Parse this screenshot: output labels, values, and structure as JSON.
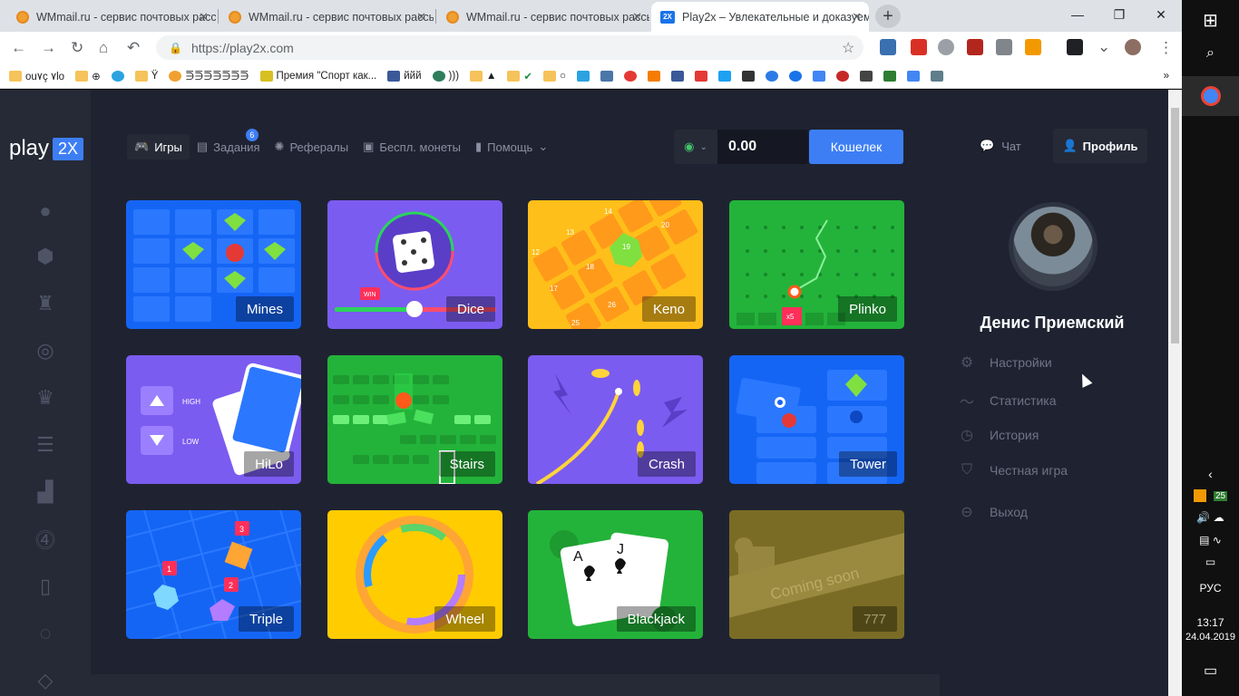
{
  "browser": {
    "tabs": [
      {
        "title": "WMmail.ru - сервис почтовых рассы",
        "active": false
      },
      {
        "title": "WMmail.ru - сервис почтовых рассы",
        "active": false
      },
      {
        "title": "WMmail.ru - сервис почтовых рассы",
        "active": false
      },
      {
        "title": "Play2x – Увлекательные и доказуем",
        "active": true,
        "favicon": "2X"
      }
    ],
    "url": "https://play2x.com",
    "window_controls": {
      "minimize": "—",
      "maximize": "❐",
      "close": "✕"
    },
    "bookmarks": [
      "ou٧ç ٧lo",
      "⊕",
      "",
      "Ÿ",
      "⋽⋽⋽⋽⋽⋽⋽",
      "Премия \"Спорт как...",
      "ййй",
      ")))",
      "▲",
      "✔",
      "○"
    ]
  },
  "taskbar": {
    "lang": "РУС",
    "time": "13:17",
    "date": "24.04.2019",
    "notif_count": "25"
  },
  "site": {
    "logo_text": "play",
    "logo_badge": "2X",
    "menu": [
      {
        "label": "Игры",
        "icon": "gamepad-icon",
        "active": true
      },
      {
        "label": "Задания",
        "icon": "list-icon",
        "badge": "6"
      },
      {
        "label": "Рефералы",
        "icon": "referral-icon"
      },
      {
        "label": "Беспл. монеты",
        "icon": "gift-icon"
      },
      {
        "label": "Помощь",
        "icon": "help-icon"
      }
    ],
    "balance": "0.00",
    "wallet_button": "Кошелек",
    "chat_label": "Чат",
    "profile_button": "Профиль",
    "user_name": "Денис Приемский",
    "profile_links": [
      {
        "label": "Настройки",
        "icon": "gear-icon"
      },
      {
        "label": "Статистика",
        "icon": "stats-icon"
      },
      {
        "label": "История",
        "icon": "clock-icon"
      },
      {
        "label": "Честная игра",
        "icon": "shield-icon"
      },
      {
        "label": "Выход",
        "icon": "logout-icon"
      }
    ],
    "games": [
      {
        "name": "Mines",
        "color": "#1565f5"
      },
      {
        "name": "Dice",
        "color": "#7b5cf0"
      },
      {
        "name": "Keno",
        "color": "#ffbf1a"
      },
      {
        "name": "Plinko",
        "color": "#23b33a"
      },
      {
        "name": "HiLo",
        "color": "#7b5cf0"
      },
      {
        "name": "Stairs",
        "color": "#23b33a"
      },
      {
        "name": "Crash",
        "color": "#7b5cf0"
      },
      {
        "name": "Tower",
        "color": "#1565f5"
      },
      {
        "name": "Triple",
        "color": "#1565f5"
      },
      {
        "name": "Wheel",
        "color": "#ffcc00"
      },
      {
        "name": "Blackjack",
        "color": "#23b33a"
      },
      {
        "name": "777",
        "color": "#8a7a2a"
      }
    ],
    "hilo_high": "HIGH",
    "hilo_low": "LOW",
    "coming_soon": "Coming soon",
    "dice_win": "WIN",
    "plinko_multiplier": "x5",
    "keno_numbers": [
      "14",
      "20",
      "13",
      "19",
      "12",
      "18",
      "17",
      "26",
      "25"
    ],
    "triple_numbers": [
      "1",
      "2",
      "3"
    ],
    "blackjack_cards": [
      "A",
      "J"
    ]
  }
}
